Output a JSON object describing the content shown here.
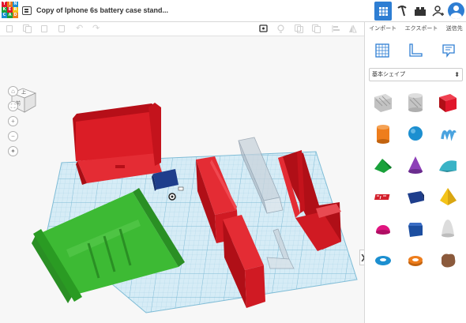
{
  "app": {
    "logo_letters": [
      "T",
      "I",
      "N",
      "K",
      "E",
      "R",
      "C",
      "A",
      "D"
    ],
    "document_title": "Copy of Iphone 6s battery case stand..."
  },
  "header_icons": [
    "grid-view-icon",
    "pickaxe-icon",
    "bricks-icon",
    "add-user-icon",
    "user-avatar-icon"
  ],
  "toolbar_icons": [
    "new-icon",
    "copy-icon",
    "paste-icon",
    "delete-icon",
    "undo-icon",
    "redo-icon",
    "note-icon",
    "light-icon",
    "group-icon",
    "ungroup-icon",
    "align-icon",
    "mirror-icon"
  ],
  "view_cube": {
    "top_label": "上",
    "front_label": "前"
  },
  "nav_controls": [
    "home-view",
    "fit-view",
    "zoom-in",
    "zoom-out",
    "orthographic-toggle"
  ],
  "panel": {
    "tabs": [
      "インポート",
      "エクスポート",
      "送信先"
    ],
    "tool_icons": [
      "workplane-icon",
      "ruler-icon",
      "notes-icon"
    ],
    "shape_category": "基本シェイプ",
    "expand_arrow": "❯"
  },
  "shapes": [
    {
      "name": "box-hole",
      "color": "#b8b8b8"
    },
    {
      "name": "cylinder-hole",
      "color": "#c4c4c4"
    },
    {
      "name": "box",
      "color": "#e0162b"
    },
    {
      "name": "cylinder",
      "color": "#ee7d1c"
    },
    {
      "name": "sphere",
      "color": "#1c8fd0"
    },
    {
      "name": "scribble",
      "color": "#4aa3df"
    },
    {
      "name": "roof",
      "color": "#19a13a"
    },
    {
      "name": "cone",
      "color": "#8d3fb8"
    },
    {
      "name": "round-roof",
      "color": "#3ab3c6"
    },
    {
      "name": "text",
      "color": "#d31f2b"
    },
    {
      "name": "wedge",
      "color": "#1e3e8c"
    },
    {
      "name": "pyramid",
      "color": "#f4c319"
    },
    {
      "name": "half-sphere",
      "color": "#e0157f"
    },
    {
      "name": "polygon",
      "color": "#1c4ea0"
    },
    {
      "name": "paraboloid",
      "color": "#d6d6d6"
    },
    {
      "name": "torus",
      "color": "#1c8fd0"
    },
    {
      "name": "tube",
      "color": "#ee7d1c"
    },
    {
      "name": "icon",
      "color": "#8b5a3c"
    }
  ],
  "colors": {
    "accent": "#2e7ed3",
    "red_part": "#d8131f",
    "green_part": "#35b82f",
    "blue_part": "#1e3e8c",
    "workplane": "#cfe8f3"
  }
}
